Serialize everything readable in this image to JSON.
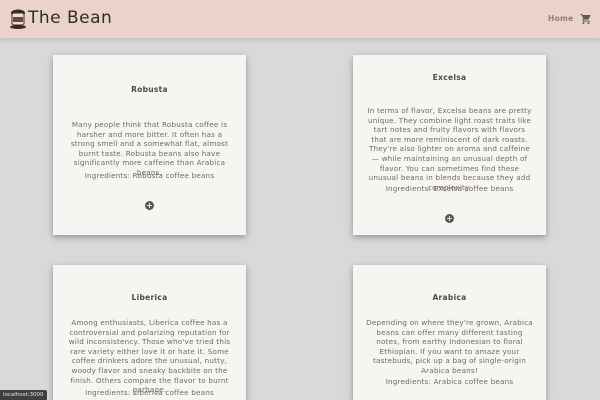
{
  "header": {
    "brand": "The Bean",
    "nav_home": "Home",
    "logo_icon": "coffee-cup-logo-icon",
    "cart_icon": "shopping-cart-icon",
    "bar_color": "#ebd2cb"
  },
  "products": [
    {
      "name": "Robusta",
      "description": "Many people think that Robusta coffee is harsher and more bitter. It often has a strong smell and a somewhat flat, almost burnt taste. Robusta beans also have significantly more caffeine than Arabica beans.",
      "ingredients": "Ingredients: Robusta coffee beans",
      "add_icon": "plus-circle-icon"
    },
    {
      "name": "Excelsa",
      "description": "In terms of flavor, Excelsa beans are pretty unique. They combine light roast traits like tart notes and fruity flavors with flavors that are more reminiscent of dark roasts. They're also lighter on aroma and caffeine — while maintaining an unusual depth of flavor. You can sometimes find these unusual beans in blends because they add complexity.",
      "ingredients": "Ingredients: Excelsa coffee beans",
      "add_icon": "plus-circle-icon"
    },
    {
      "name": "Liberica",
      "description": "Among enthusiasts, Liberica coffee has a controversial and polarizing reputation for wild inconsistency. Those who've tried this rare variety either love it or hate it. Some coffee drinkers adore the unusual, nutty, woody flavor and sneaky backbite on the finish. Others compare the flavor to burnt garbage.",
      "ingredients": "Ingredients: Liberica coffee beans",
      "add_icon": "plus-circle-icon"
    },
    {
      "name": "Arabica",
      "description": "Depending on where they're grown, Arabica beans can offer many different tasting notes, from earthy Indonesian to floral Ethiopian. If you want to amaze your tastebuds, pick up a bag of single-origin Arabica beans!",
      "ingredients": "Ingredients: Arabica coffee beans",
      "add_icon": "plus-circle-icon"
    }
  ],
  "status_bar": "localhost:3000"
}
